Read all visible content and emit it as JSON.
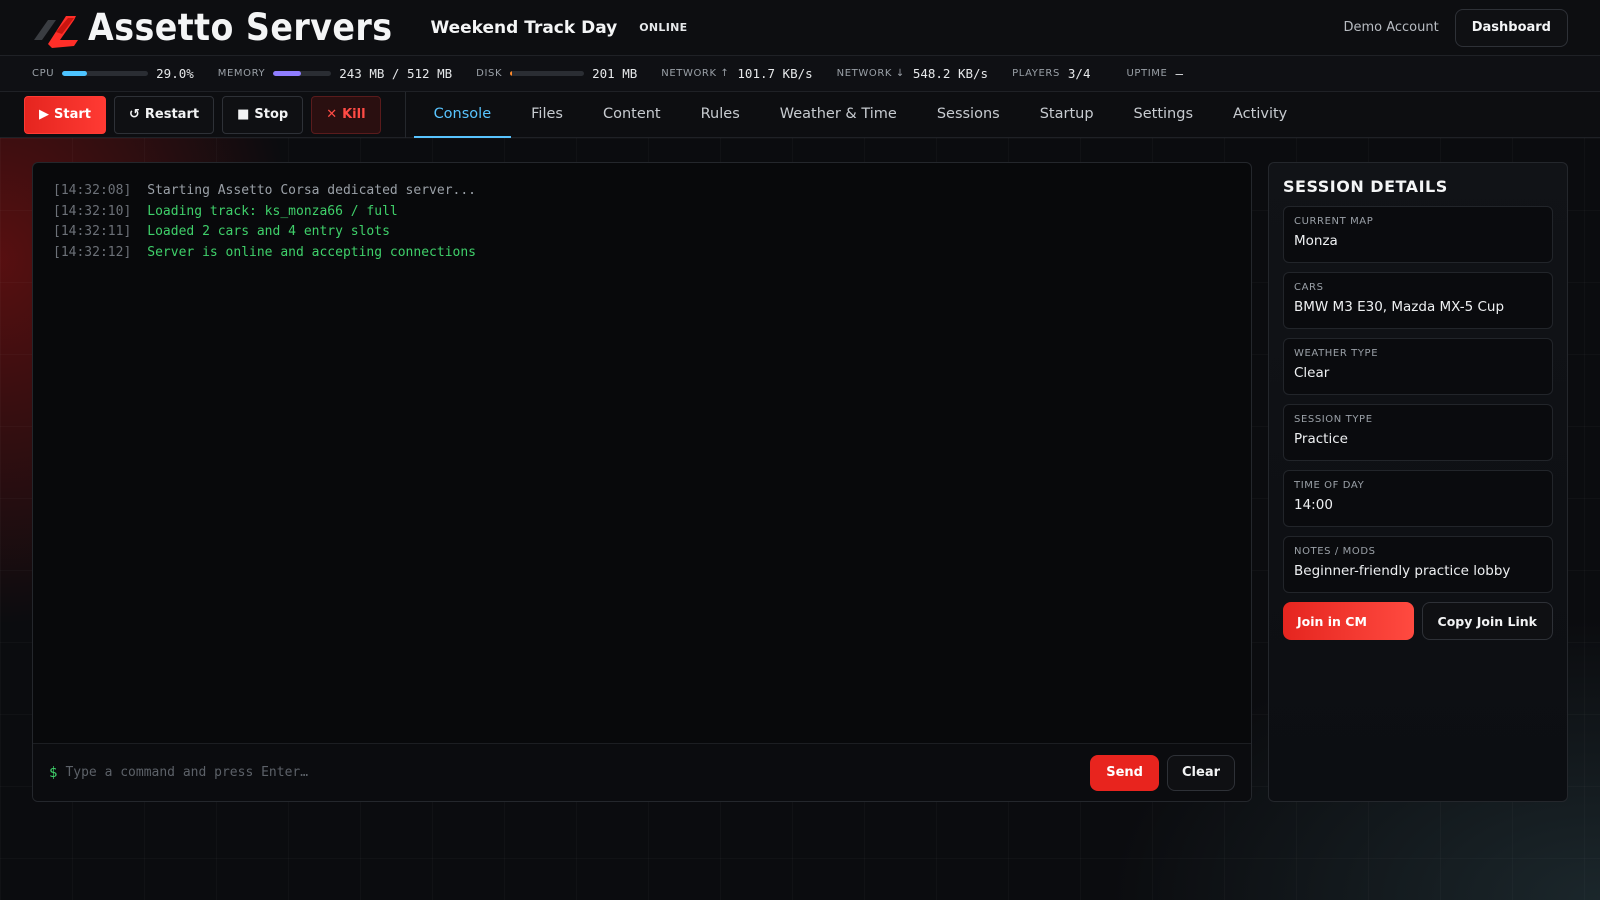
{
  "header": {
    "brand": "Assetto Servers",
    "server_name": "Weekend Track Day",
    "status": "ONLINE",
    "account": "Demo Account",
    "dashboard_label": "Dashboard",
    "logo_icon": "racing-stripes-logo"
  },
  "stats": {
    "cpu": {
      "label": "CPU",
      "value": "29.0%",
      "percent": 29,
      "color": "#4cc3ff"
    },
    "memory": {
      "label": "MEMORY",
      "value": "243 MB / 512 MB",
      "percent": 47,
      "color": "#8f7dff"
    },
    "disk": {
      "label": "DISK",
      "value": "201 MB",
      "percent": 2,
      "color": "#ff8a2a"
    },
    "net_up": {
      "label": "NETWORK ↑",
      "value": "101.7 KB/s"
    },
    "net_down": {
      "label": "NETWORK ↓",
      "value": "548.2 KB/s"
    },
    "players": {
      "label": "PLAYERS",
      "value": "3/4"
    },
    "uptime": {
      "label": "UPTIME",
      "value": "—"
    }
  },
  "actions": {
    "start": {
      "glyph": "▶",
      "label": "Start"
    },
    "restart": {
      "glyph": "↺",
      "label": "Restart"
    },
    "stop": {
      "glyph": "■",
      "label": "Stop"
    },
    "kill": {
      "glyph": "✕",
      "label": "Kill"
    }
  },
  "tabs": [
    {
      "label": "Console",
      "active": true
    },
    {
      "label": "Files"
    },
    {
      "label": "Content"
    },
    {
      "label": "Rules"
    },
    {
      "label": "Weather & Time"
    },
    {
      "label": "Sessions"
    },
    {
      "label": "Startup"
    },
    {
      "label": "Settings"
    },
    {
      "label": "Activity"
    }
  ],
  "console": {
    "lines": [
      {
        "time": "[14:32:08]",
        "text": "Starting Assetto Corsa dedicated server..."
      },
      {
        "time": "[14:32:10]",
        "text": "Loading track: ks_monza66 / full"
      },
      {
        "time": "[14:32:11]",
        "text": "Loaded 2 cars and 4 entry slots"
      },
      {
        "time": "[14:32:12]",
        "text": "Server is online and accepting connections"
      }
    ],
    "prompt": "$",
    "placeholder": "Type a command and press Enter…",
    "send_label": "Send",
    "clear_label": "Clear"
  },
  "session": {
    "title": "SESSION DETAILS",
    "fields": [
      {
        "label": "CURRENT MAP",
        "value": "Monza"
      },
      {
        "label": "CARS",
        "value": "BMW M3 E30, Mazda MX-5 Cup"
      },
      {
        "label": "WEATHER TYPE",
        "value": "Clear"
      },
      {
        "label": "SESSION TYPE",
        "value": "Practice"
      },
      {
        "label": "TIME OF DAY",
        "value": "14:00"
      },
      {
        "label": "NOTES / MODS",
        "value": "Beginner-friendly practice lobby"
      }
    ],
    "join_label": "Join in CM",
    "copy_label": "Copy Join Link"
  }
}
